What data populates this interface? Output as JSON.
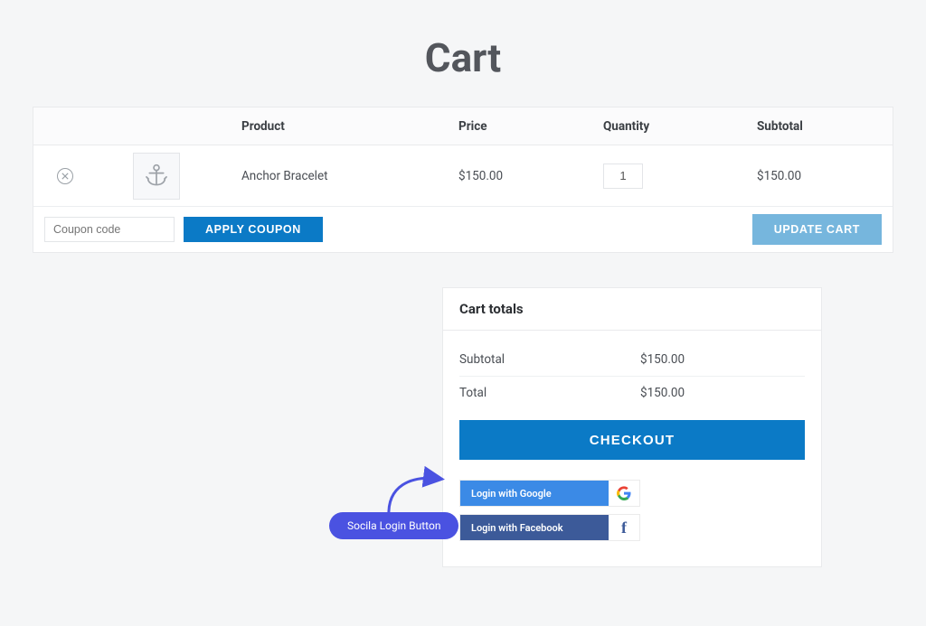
{
  "page": {
    "title": "Cart"
  },
  "table": {
    "headers": {
      "product": "Product",
      "price": "Price",
      "qty": "Quantity",
      "subtotal": "Subtotal"
    },
    "rows": [
      {
        "product": "Anchor Bracelet",
        "price": "$150.00",
        "qty": "1",
        "subtotal": "$150.00"
      }
    ]
  },
  "coupon": {
    "placeholder": "Coupon code",
    "apply": "APPLY COUPON"
  },
  "update_cart": "UPDATE CART",
  "totals": {
    "heading": "Cart totals",
    "rows": {
      "subtotal_label": "Subtotal",
      "subtotal_val": "$150.00",
      "total_label": "Total",
      "total_val": "$150.00"
    },
    "checkout": "CHECKOUT"
  },
  "social": {
    "google": "Login with Google",
    "facebook": "Login with Facebook"
  },
  "annotation": {
    "label": "Socila Login Button"
  }
}
